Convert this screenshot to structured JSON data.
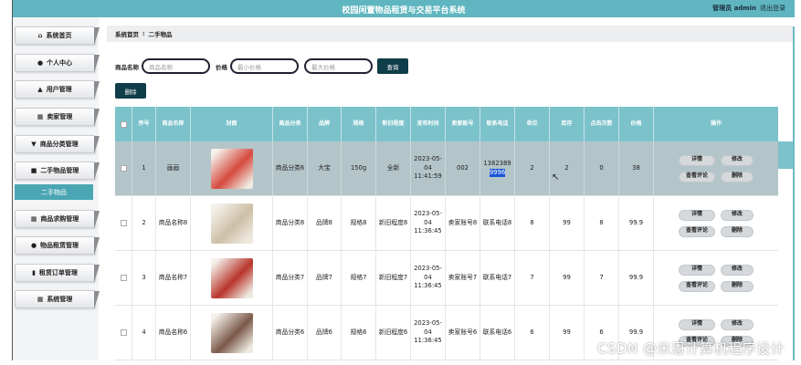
{
  "header": {
    "title": "校园闲置物品租赁与交易平台系统",
    "user": "管理员 admin",
    "logout": "退出登录"
  },
  "sidebar": {
    "items": [
      {
        "label": "系统首页",
        "icon": "home-icon"
      },
      {
        "label": "个人中心",
        "icon": "user-icon"
      },
      {
        "label": "用户管理",
        "icon": "bank-icon"
      },
      {
        "label": "卖家管理",
        "icon": "grid-icon"
      },
      {
        "label": "商品分类管理",
        "icon": "filter-icon"
      },
      {
        "label": "二手物品管理",
        "icon": "film-icon"
      }
    ],
    "active_sub": "二手物品",
    "items_after": [
      {
        "label": "商品求购管理",
        "icon": "grid-icon"
      },
      {
        "label": "物品租赁管理",
        "icon": "user-icon"
      },
      {
        "label": "租赁订单管理",
        "icon": "file-icon"
      },
      {
        "label": "系统管理",
        "icon": "grid-icon"
      }
    ]
  },
  "breadcrumb": {
    "home": "系统首页",
    "sep": "⁝",
    "current": "二手物品"
  },
  "search": {
    "name_label": "商品名称",
    "name_placeholder": "商品名称",
    "price_label": "价格",
    "min_placeholder": "最小价格",
    "max_placeholder": "最大价格",
    "query_button": "查询"
  },
  "delete_button": "删除",
  "table": {
    "headers": [
      "序号",
      "商品名称",
      "封面",
      "商品分类",
      "品牌",
      "规格",
      "新旧程度",
      "发布时间",
      "卖家账号",
      "联系电话",
      "单位",
      "库存",
      "点击次数",
      "价格",
      "操作"
    ],
    "rows": [
      {
        "no": "1",
        "name": "画画",
        "category": "商品分类6",
        "brand": "大宝",
        "spec": "150g",
        "condition": "全新",
        "time": "2023-05-04 11:41:59",
        "seller": "002",
        "phone_a": "1382389",
        "phone_b": "9996",
        "unit": "2",
        "stock": "2",
        "clicks": "0",
        "price": "38",
        "thumb": "#d64a3e"
      },
      {
        "no": "2",
        "name": "商品名称8",
        "category": "商品分类8",
        "brand": "品牌8",
        "spec": "规格8",
        "condition": "新旧程度8",
        "time": "2023-05-04 11:36:45",
        "seller": "卖家账号8",
        "phone_a": "联系电话8",
        "phone_b": "",
        "unit": "8",
        "stock": "99",
        "clicks": "8",
        "price": "99.9",
        "thumb": "#cdbfa6"
      },
      {
        "no": "3",
        "name": "商品名称7",
        "category": "商品分类7",
        "brand": "品牌7",
        "spec": "规格7",
        "condition": "新旧程度7",
        "time": "2023-05-04 11:36:45",
        "seller": "卖家账号7",
        "phone_a": "联系电话7",
        "phone_b": "",
        "unit": "7",
        "stock": "99",
        "clicks": "7",
        "price": "99.9",
        "thumb": "#b8362b"
      },
      {
        "no": "4",
        "name": "商品名称6",
        "category": "商品分类6",
        "brand": "品牌6",
        "spec": "规格6",
        "condition": "新旧程度6",
        "time": "2023-05-04 11:36:45",
        "seller": "卖家账号6",
        "phone_a": "联系电话6",
        "phone_b": "",
        "unit": "6",
        "stock": "99",
        "clicks": "6",
        "price": "99.9",
        "thumb": "#7a5a4a"
      }
    ],
    "actions": [
      "详情",
      "修改",
      "查看评论",
      "删除"
    ]
  },
  "watermark": "CSDN @米恩计算机程序设计",
  "colors": {
    "header": "#5fb6c0",
    "table_head": "#7cc2cb",
    "active_sub": "#4aa6b2",
    "button": "#0f3d49"
  }
}
